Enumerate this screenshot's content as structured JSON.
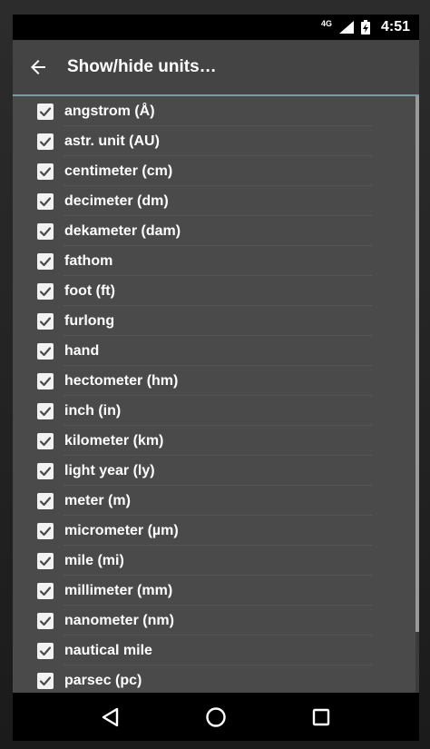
{
  "status_bar": {
    "network_type": "4G",
    "time": "4:51",
    "icons": [
      "signal-icon",
      "battery-charging-icon"
    ]
  },
  "app_bar": {
    "title": "Show/hide units…",
    "back_icon": "arrow-back-icon"
  },
  "colors": {
    "background": "#4a4a4a",
    "app_bar": "#444444",
    "accent_line": "#7f9aa2",
    "status_bar": "#000000",
    "checkbox": "#f2f2f2",
    "text": "#ffffff"
  },
  "units": [
    {
      "label": "angstrom (Å)",
      "checked": true
    },
    {
      "label": "astr. unit (AU)",
      "checked": true
    },
    {
      "label": "centimeter (cm)",
      "checked": true
    },
    {
      "label": "decimeter (dm)",
      "checked": true
    },
    {
      "label": "dekameter (dam)",
      "checked": true
    },
    {
      "label": "fathom",
      "checked": true
    },
    {
      "label": "foot (ft)",
      "checked": true
    },
    {
      "label": "furlong",
      "checked": true
    },
    {
      "label": "hand",
      "checked": true
    },
    {
      "label": "hectometer (hm)",
      "checked": true
    },
    {
      "label": "inch (in)",
      "checked": true
    },
    {
      "label": "kilometer (km)",
      "checked": true
    },
    {
      "label": "light year (ly)",
      "checked": true
    },
    {
      "label": "meter (m)",
      "checked": true
    },
    {
      "label": "micrometer (µm)",
      "checked": true
    },
    {
      "label": "mile (mi)",
      "checked": true
    },
    {
      "label": "millimeter (mm)",
      "checked": true
    },
    {
      "label": "nanometer (nm)",
      "checked": true
    },
    {
      "label": "nautical mile",
      "checked": true
    },
    {
      "label": "parsec (pc)",
      "checked": true
    }
  ],
  "nav_bar": {
    "buttons": [
      "back-triangle-icon",
      "home-circle-icon",
      "recents-square-icon"
    ]
  }
}
